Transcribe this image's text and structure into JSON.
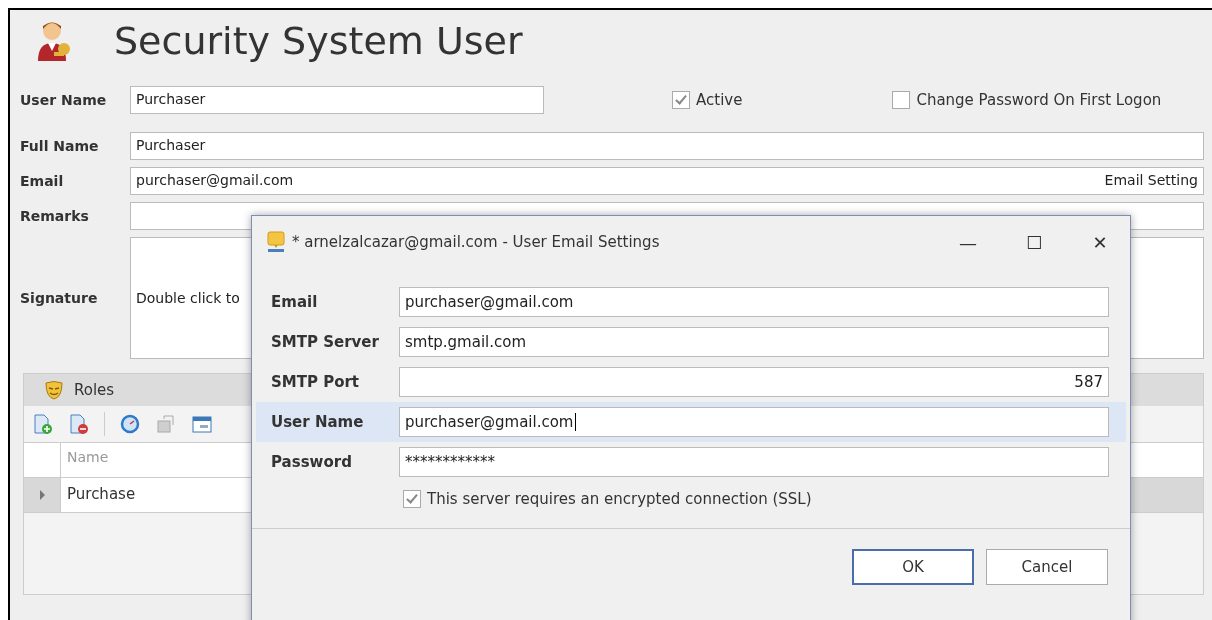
{
  "window": {
    "title": "Security System User"
  },
  "form": {
    "user_name": {
      "label": "User Name",
      "value": "Purchaser"
    },
    "active": {
      "label": "Active",
      "checked": true
    },
    "change_password": {
      "label": "Change Password On First Logon",
      "checked": false
    },
    "full_name": {
      "label": "Full Name",
      "value": "Purchaser"
    },
    "email": {
      "label": "Email",
      "value": "purchaser@gmail.com",
      "button": "Email Setting"
    },
    "remarks": {
      "label": "Remarks"
    },
    "signature": {
      "label": "Signature",
      "value": "Double click to"
    }
  },
  "roles": {
    "title": "Roles",
    "columns": [
      "Name"
    ],
    "rows": [
      {
        "name": "Purchase",
        "selected": true
      }
    ]
  },
  "dialog": {
    "title": "* arnelzalcazar@gmail.com - User Email Settings",
    "controls": [
      "—",
      "☐",
      "✕"
    ],
    "fields": [
      {
        "label": "Email",
        "value": "purchaser@gmail.com",
        "kind": "text",
        "focused": false
      },
      {
        "label": "SMTP Server",
        "value": "smtp.gmail.com",
        "kind": "text",
        "focused": false
      },
      {
        "label": "SMTP Port",
        "value": "587",
        "kind": "number",
        "focused": false
      },
      {
        "label": "User Name",
        "value": "purchaser@gmail.com",
        "kind": "text",
        "focused": true
      },
      {
        "label": "Password",
        "value": "************",
        "kind": "password",
        "focused": false
      }
    ],
    "ssl": {
      "label": "This server requires an encrypted connection (SSL)",
      "checked": true
    },
    "buttons": [
      {
        "label": "OK",
        "default": true
      },
      {
        "label": "Cancel",
        "default": false
      }
    ]
  }
}
